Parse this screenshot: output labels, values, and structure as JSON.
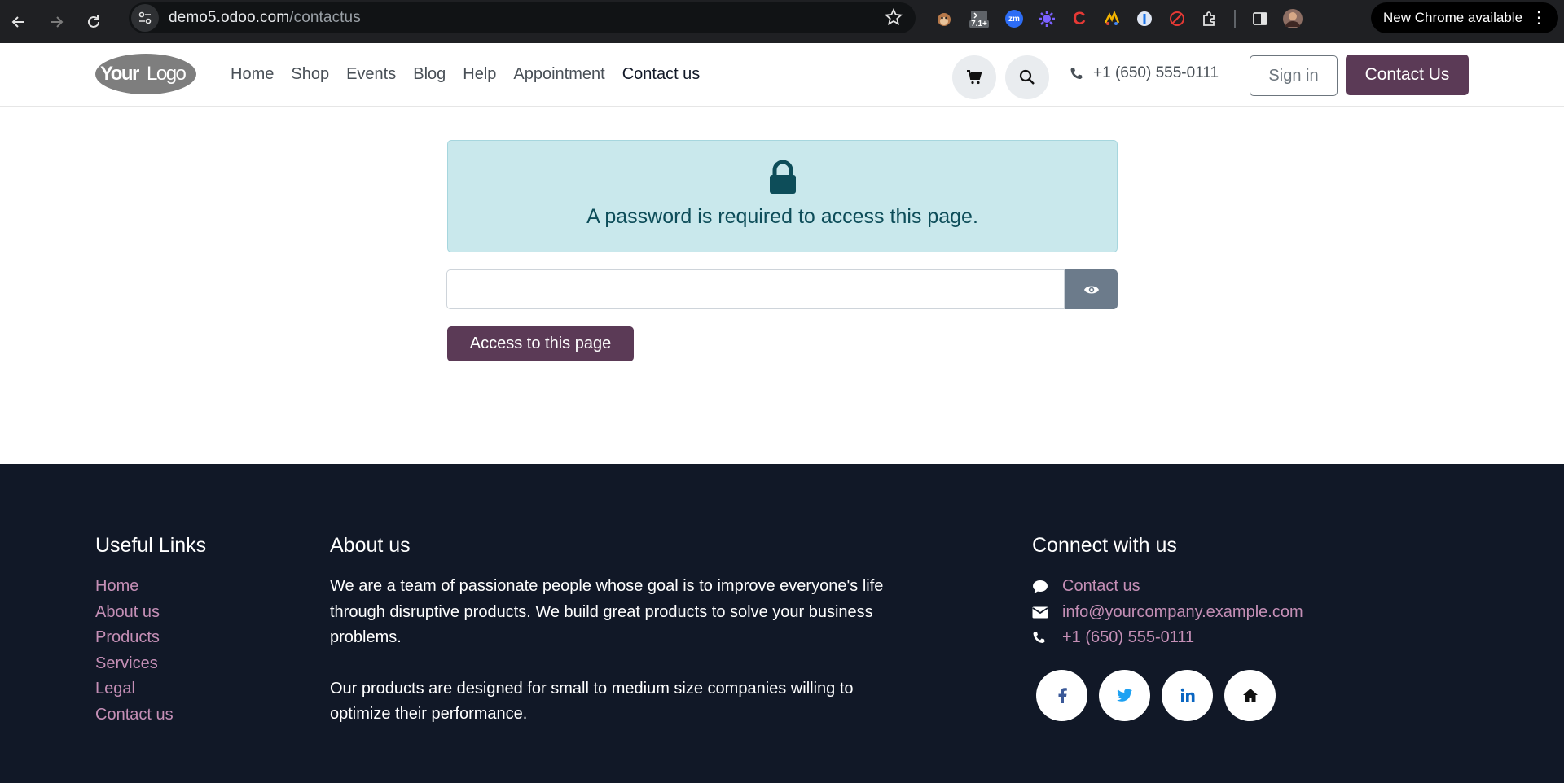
{
  "browser": {
    "url_domain": "demo5.odoo.com",
    "url_path": "/contactus",
    "extension_badge": "7.1+",
    "extension_zm_label": "zm",
    "update_label": "New Chrome available"
  },
  "header": {
    "logo_text_a": "Your",
    "logo_text_b": "Logo",
    "nav": [
      "Home",
      "Shop",
      "Events",
      "Blog",
      "Help",
      "Appointment",
      "Contact us"
    ],
    "phone": "+1 (650) 555-0111",
    "sign_in_label": "Sign in",
    "contact_button_label": "Contact Us"
  },
  "main": {
    "alert_message": "A password is required to access this page.",
    "password_value": "",
    "access_button_label": "Access to this page"
  },
  "footer": {
    "useful_links": {
      "title": "Useful Links",
      "items": [
        "Home",
        "About us",
        "Products",
        "Services",
        "Legal",
        "Contact us"
      ]
    },
    "about": {
      "title": "About us",
      "paragraphs": [
        "We are a team of passionate people whose goal is to improve everyone's life through disruptive products. We build great products to solve your business problems.",
        "Our products are designed for small to medium size companies willing to optimize their performance."
      ]
    },
    "connect": {
      "title": "Connect with us",
      "contact_label": "Contact us",
      "email": "info@yourcompany.example.com",
      "phone": "+1 (650) 555-0111",
      "social": [
        "facebook-icon",
        "twitter-icon",
        "linkedin-icon",
        "home-icon"
      ]
    }
  },
  "colors": {
    "brand": "#5b3a56",
    "footer_bg": "#111827",
    "footer_link": "#c58fb6",
    "alert_bg": "#c9e8ec",
    "alert_text": "#0d4d59"
  }
}
